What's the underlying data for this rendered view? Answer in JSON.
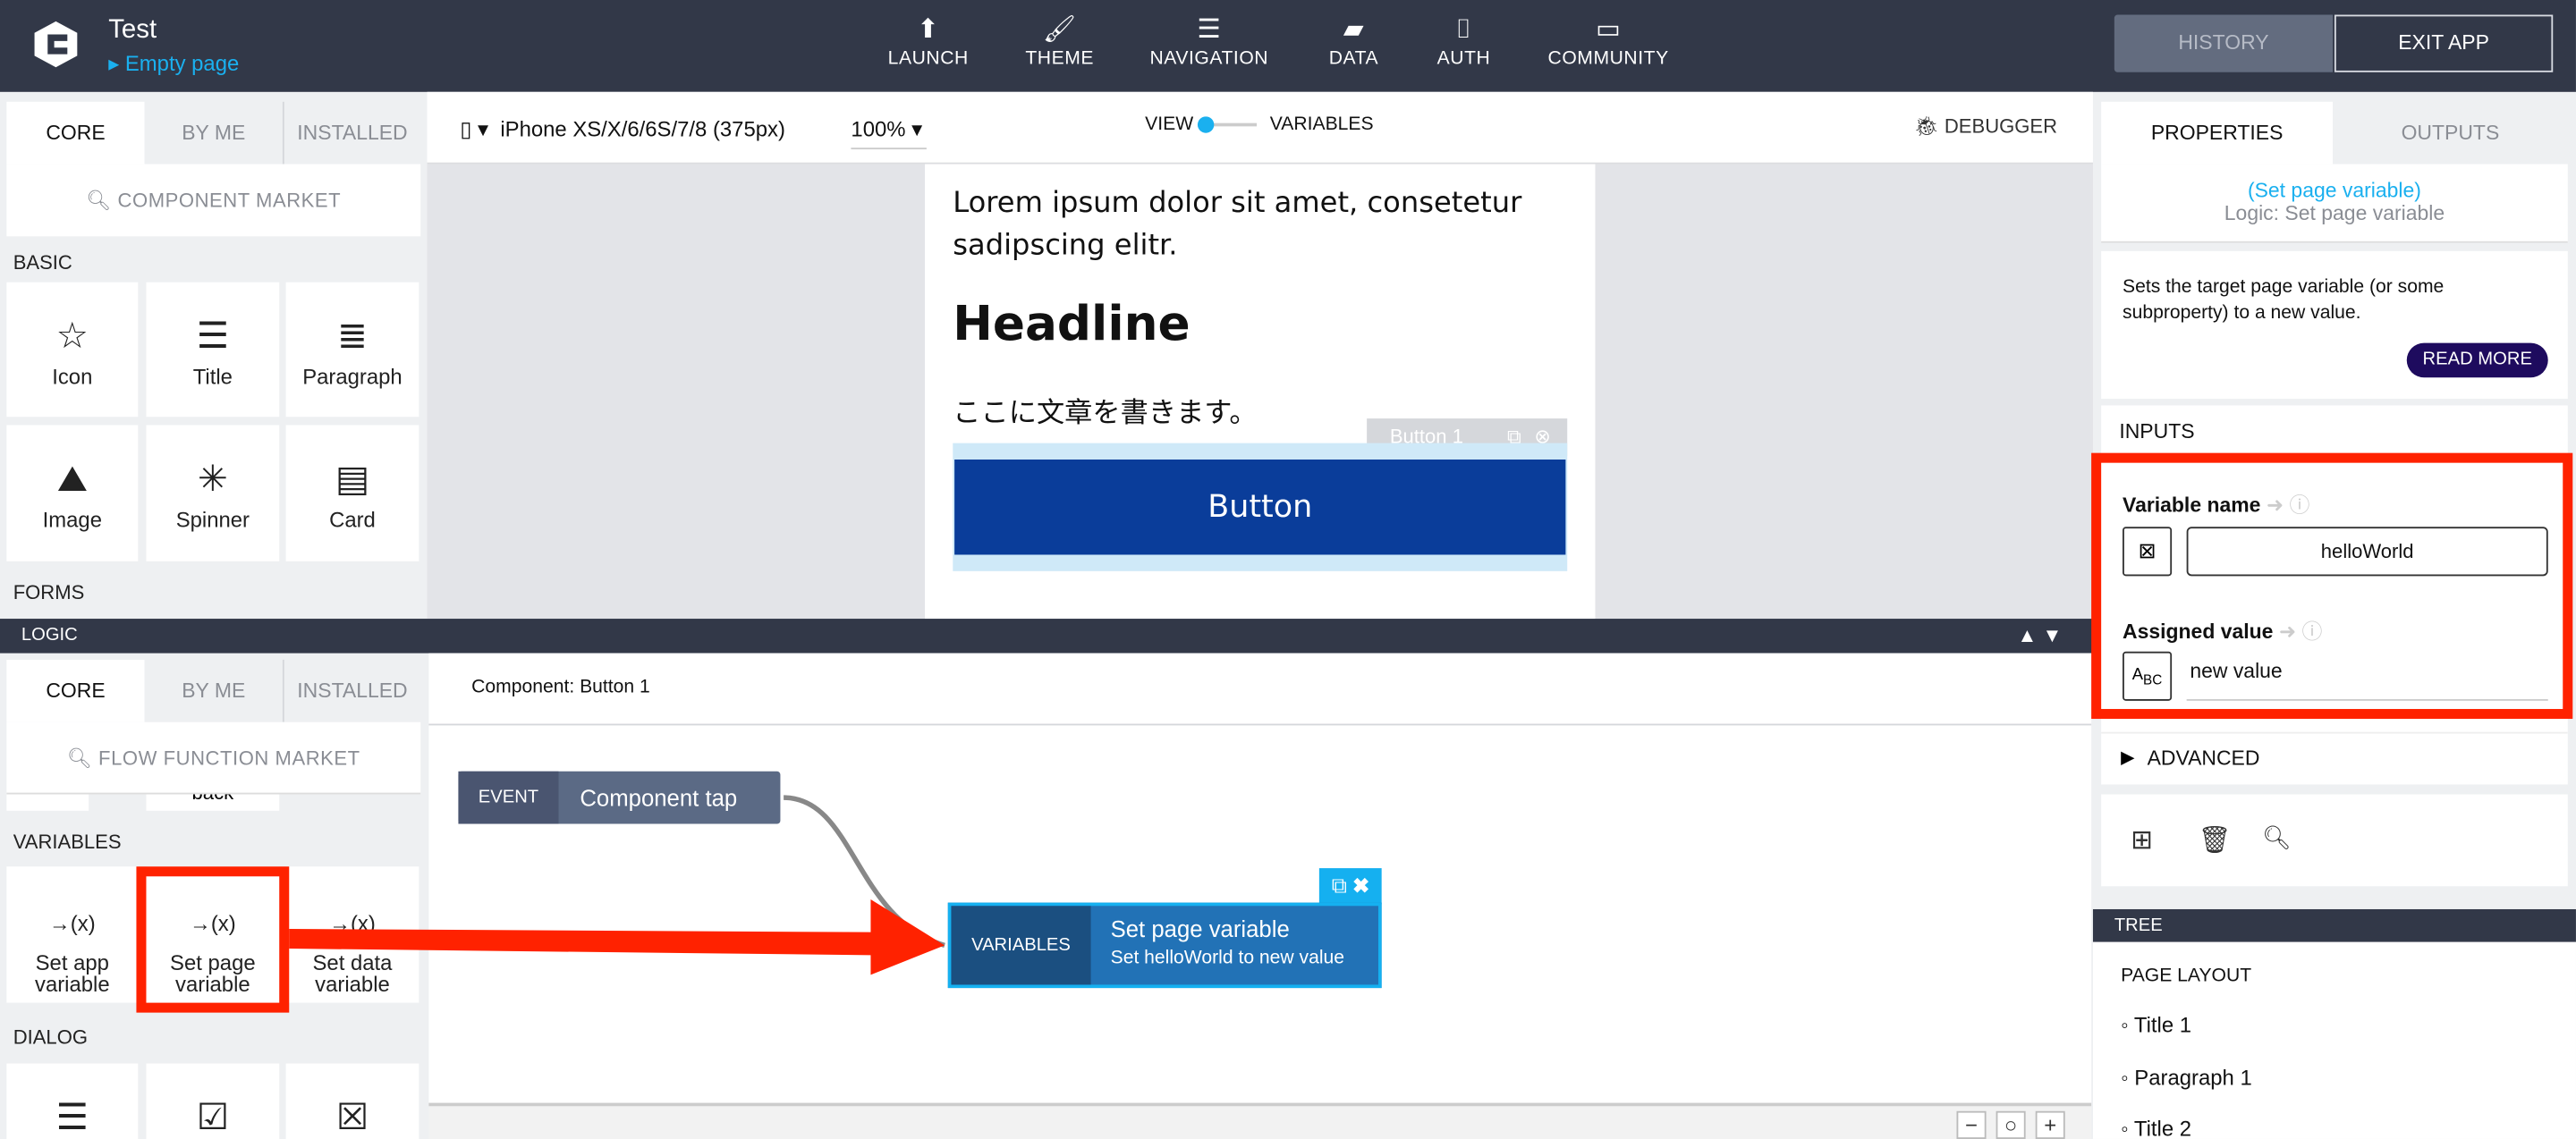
{
  "app": {
    "title": "Test",
    "page": "Empty page"
  },
  "nav": [
    {
      "label": "LAUNCH",
      "icon": "upload-circle-icon"
    },
    {
      "label": "THEME",
      "icon": "brush-icon"
    },
    {
      "label": "NAVIGATION",
      "icon": "list-icon"
    },
    {
      "label": "DATA",
      "icon": "folder-icon"
    },
    {
      "label": "AUTH",
      "icon": "code-file-icon"
    },
    {
      "label": "COMMUNITY",
      "icon": "chat-icon"
    }
  ],
  "header_buttons": {
    "history": "HISTORY",
    "exit": "EXIT APP"
  },
  "left": {
    "tabs": [
      "CORE",
      "BY ME",
      "INSTALLED"
    ],
    "search": "COMPONENT MARKET",
    "basic": "BASIC",
    "tiles": [
      "Icon",
      "Title",
      "Paragraph",
      "Image",
      "Spinner",
      "Card"
    ],
    "forms": "FORMS"
  },
  "toolbar": {
    "device": "iPhone XS/X/6/6S/7/8 (375px)",
    "zoom": "100%",
    "view": "VIEW",
    "variables": "VARIABLES",
    "debugger": "DEBUGGER"
  },
  "phone": {
    "lorem": "Lorem ipsum dolor sit amet, consetetur sadipscing elitr.",
    "headline": "Headline",
    "japanese": "ここに文章を書きます。",
    "button_tag": "Button 1",
    "button": "Button"
  },
  "logic": {
    "title": "LOGIC",
    "tabs": [
      "CORE",
      "BY ME",
      "INSTALLED"
    ],
    "search": "FLOW FUNCTION MARKET",
    "partial": "back",
    "variables": "VARIABLES",
    "tiles": [
      "Set app variable",
      "Set page variable",
      "Set data variable"
    ],
    "dialog": "DIALOG",
    "component": "Component: Button 1",
    "event_node": {
      "tag": "EVENT",
      "label": "Component tap"
    },
    "var_node": {
      "tag": "VARIABLES",
      "title": "Set page variable",
      "subtitle": "Set helloWorld to new value"
    }
  },
  "right": {
    "tabs": [
      "PROPERTIES",
      "OUTPUTS"
    ],
    "link": "(Set page variable)",
    "subtitle": "Logic: Set page variable",
    "description": "Sets the target page variable (or some subproperty) to a new value.",
    "read_more": "READ MORE",
    "inputs": "INPUTS",
    "var_label": "Variable name",
    "var_value": "helloWorld",
    "assigned_label": "Assigned value",
    "assigned_value": "new value",
    "advanced": "ADVANCED",
    "tree": "TREE",
    "page_layout": "PAGE LAYOUT",
    "tree_items": [
      "Title 1",
      "Paragraph 1",
      "Title 2"
    ]
  },
  "colors": {
    "topbar": "#323848",
    "accent": "#1ab0ef",
    "button": "#0a3d9a",
    "highlight": "#ff2200",
    "readmore": "#1e0b5e"
  }
}
